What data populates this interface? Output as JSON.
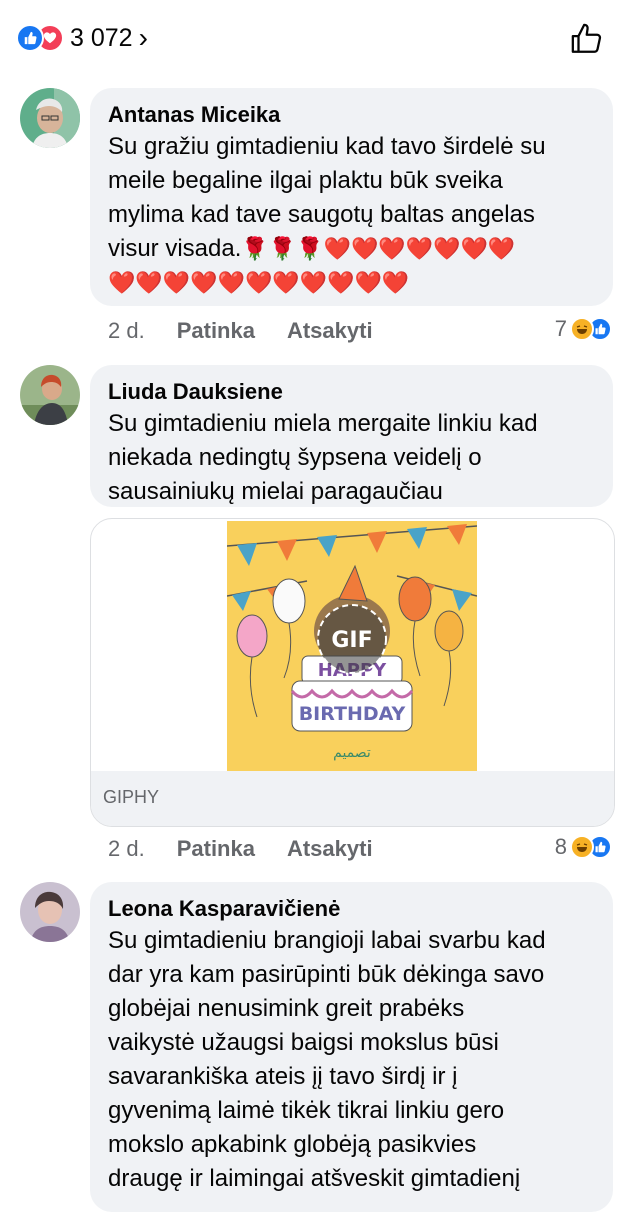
{
  "header": {
    "reaction_count": "3 072",
    "chevron": "›"
  },
  "comments": [
    {
      "author": "Antanas Miceika",
      "text": "Su gražiu gimtadieniu kad tavo širdelė su\nmeile begaline ilgai plaktu būk sveika\nmylima kad tave saugotų baltas angelas\nvisur visada.",
      "emoji_line1": "🌹🌹🌹❤️❤️❤️❤️❤️❤️❤️",
      "emoji_line2": "❤️❤️❤️❤️❤️❤️❤️❤️❤️❤️❤️",
      "time": "2 d.",
      "like_label": "Patinka",
      "reply_label": "Atsakyti",
      "reactions": "7"
    },
    {
      "author": "Liuda Dauksiene",
      "text": "Su gimtadieniu miela mergaite linkiu kad\nniekada nedingtų šypsena veidelį o\nsausainiukų mielai paragaučiau",
      "gif_badge": "GIF",
      "gif_source": "GIPHY",
      "gif_lines": [
        "HAPPY",
        "BIRTHDAY",
        "تصميم"
      ],
      "time": "2 d.",
      "like_label": "Patinka",
      "reply_label": "Atsakyti",
      "reactions": "8"
    },
    {
      "author": "Leona Kasparavičienė",
      "text": "Su gimtadieniu brangioji labai svarbu kad\ndar yra kam pasirūpinti būk dėkinga savo\nglobėjai nenusimink  greit prabėks\nvaikystė užaugsi  baigsi mokslus būsi\nsavarankiška ateis įį tavo širdį ir į\ngyvenimą laimė tikėk tikrai linkiu gero\nmokslo apkabink globėją pasikvies\ndraugę ir laimingai atšveskit gimtadienį"
    }
  ],
  "icons": [
    "like-icon",
    "love-icon",
    "chevron-right-icon",
    "thumbs-up-icon",
    "haha-icon"
  ]
}
